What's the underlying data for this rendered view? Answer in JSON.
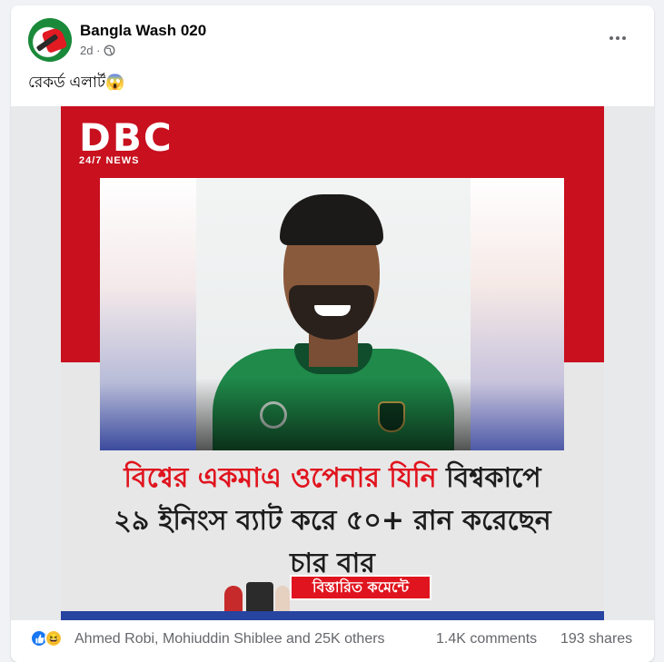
{
  "post": {
    "page_name": "Bangla Wash 020",
    "time": "2d ·",
    "text": "রেকর্ড এলার্ট😱"
  },
  "poster": {
    "logo_main": "DBC",
    "logo_sub": "24/7 NEWS",
    "headline_red": "বিশ্বের একমাএ ওপেনার যিনি",
    "headline_rest_1": " বিশ্বকাপে",
    "headline_line_2": "২৯ ইনিংস ব্যাট করে ৫০+ রান করেছেন",
    "headline_line_3": "চার বার",
    "cta_label": "বিস্তারিত কমেন্টে"
  },
  "footer": {
    "reaction_names": "Ahmed Robi, Mohiuddin Shiblee and 25K others",
    "comments": "1.4K comments",
    "shares": "193 shares"
  },
  "icons": {
    "more": "more-options-icon",
    "globe": "globe-icon",
    "like": "like-reaction-icon",
    "haha": "haha-reaction-icon"
  },
  "colors": {
    "accent_red": "#c8101e",
    "headline_red": "#e0141e",
    "like_blue": "#1877f2",
    "meta_grey": "#65676b"
  }
}
